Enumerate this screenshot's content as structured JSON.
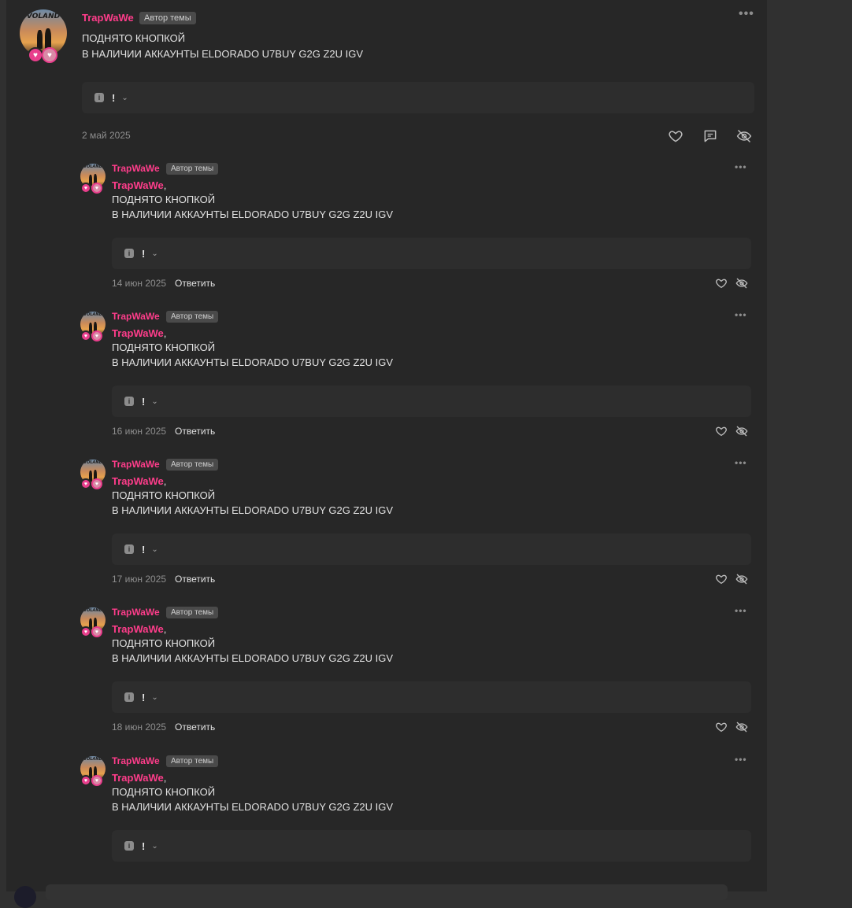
{
  "main_post": {
    "username": "TrapWaWe",
    "tag": "Автор темы",
    "line1": "ПОДНЯТО КНОПКОЙ",
    "line2": "В НАЛИЧИИ АККАУНТЫ ELDORADO U7BUY G2G Z2U IGV",
    "spoiler_title": "!",
    "date": "2 май 2025",
    "avatar_logo": "VOLAND"
  },
  "replies": [
    {
      "username": "TrapWaWe",
      "tag": "Автор темы",
      "mention": "TrapWaWe",
      "line1": "ПОДНЯТО КНОПКОЙ",
      "line2": "В НАЛИЧИИ АККАУНТЫ ELDORADO U7BUY G2G Z2U IGV",
      "spoiler_title": "!",
      "date": "14 июн 2025",
      "reply_label": "Ответить",
      "avatar_logo": "VOLAND"
    },
    {
      "username": "TrapWaWe",
      "tag": "Автор темы",
      "mention": "TrapWaWe",
      "line1": "ПОДНЯТО КНОПКОЙ",
      "line2": "В НАЛИЧИИ АККАУНТЫ ELDORADO U7BUY G2G Z2U IGV",
      "spoiler_title": "!",
      "date": "16 июн 2025",
      "reply_label": "Ответить",
      "avatar_logo": "VOLAND"
    },
    {
      "username": "TrapWaWe",
      "tag": "Автор темы",
      "mention": "TrapWaWe",
      "line1": "ПОДНЯТО КНОПКОЙ",
      "line2": "В НАЛИЧИИ АККАУНТЫ ELDORADO U7BUY G2G Z2U IGV",
      "spoiler_title": "!",
      "date": "17 июн 2025",
      "reply_label": "Ответить",
      "avatar_logo": "VOLAND"
    },
    {
      "username": "TrapWaWe",
      "tag": "Автор темы",
      "mention": "TrapWaWe",
      "line1": "ПОДНЯТО КНОПКОЙ",
      "line2": "В НАЛИЧИИ АККАУНТЫ ELDORADO U7BUY G2G Z2U IGV",
      "spoiler_title": "!",
      "date": "18 июн 2025",
      "reply_label": "Ответить",
      "avatar_logo": "VOLAND"
    },
    {
      "username": "TrapWaWe",
      "tag": "Автор темы",
      "mention": "TrapWaWe",
      "line1": "ПОДНЯТО КНОПКОЙ",
      "line2": "В НАЛИЧИИ АККАУНТЫ ELDORADO U7BUY G2G Z2U IGV",
      "spoiler_title": "!",
      "avatar_logo": "VOLAND"
    }
  ],
  "colors": {
    "accent": "#ff3d8b",
    "background": "#272727",
    "page": "#303030"
  },
  "icons": {
    "like": "heart-icon",
    "comment": "comment-icon",
    "hide": "eye-off-icon",
    "more": "more-dots-icon",
    "info": "info-icon",
    "chevron": "chevron-down-icon"
  }
}
